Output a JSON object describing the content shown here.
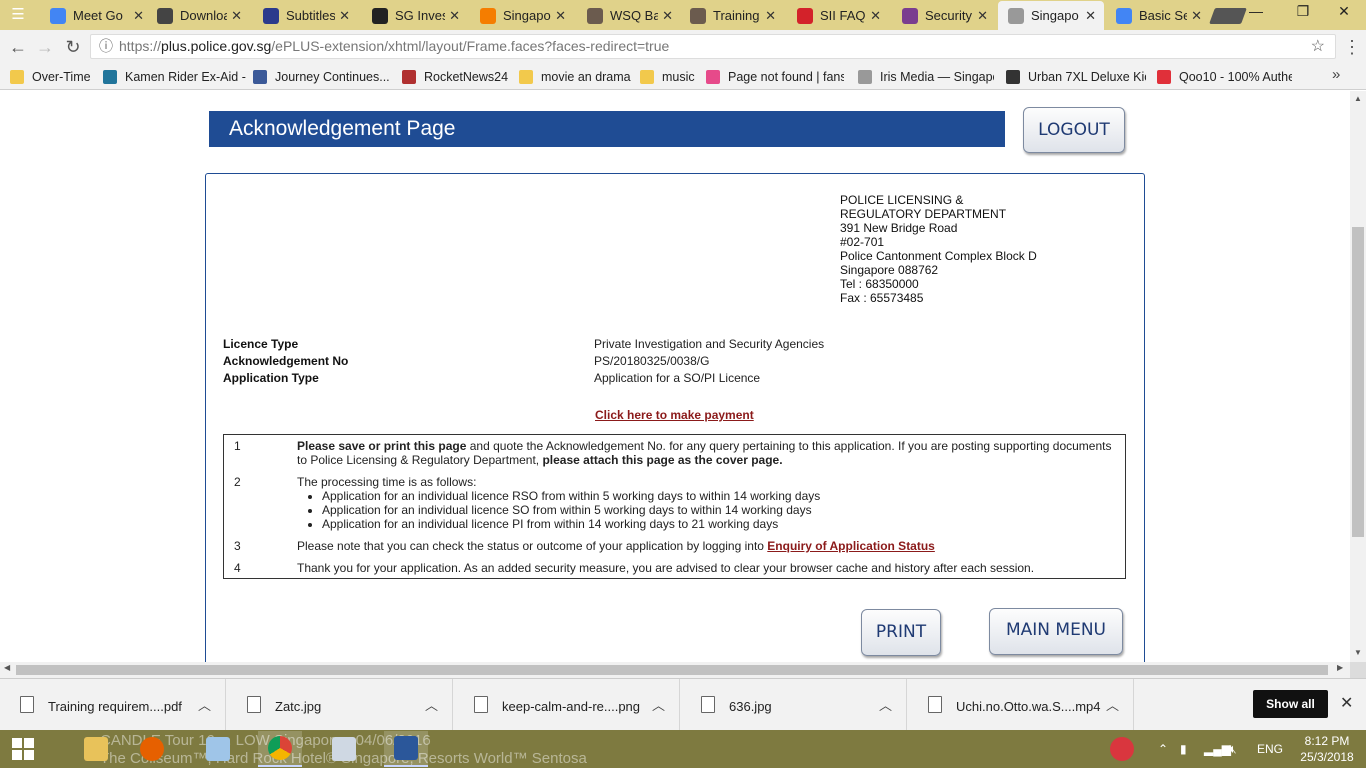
{
  "browser": {
    "tabs": [
      {
        "label": "Meet Go",
        "icon": "google-icon",
        "color": "#4285f4"
      },
      {
        "label": "Downloa",
        "icon": "user-silhouette-icon",
        "color": "#444444"
      },
      {
        "label": "Subtitles",
        "icon": "subtitles-icon",
        "color": "#2b3a8c"
      },
      {
        "label": "SG Inves",
        "icon": "sg-investigation-icon",
        "color": "#222222"
      },
      {
        "label": "Singapo",
        "icon": "blogger-icon",
        "color": "#f57d00"
      },
      {
        "label": "WSQ Ba",
        "icon": "wsq-icon",
        "color": "#6b5b4e"
      },
      {
        "label": "Training",
        "icon": "training-icon",
        "color": "#6b5b4e"
      },
      {
        "label": "SII FAQ |",
        "icon": "tp-icon",
        "color": "#d3222a"
      },
      {
        "label": "Security",
        "icon": "police-crest-icon",
        "color": "#7a3d8f"
      },
      {
        "label": "Singapo",
        "icon": "document-icon",
        "color": "#999999"
      },
      {
        "label": "Basic Se",
        "icon": "google-icon",
        "color": "#4285f4"
      }
    ],
    "url_prefix": "https://",
    "url_domain": "plus.police.gov.sg",
    "url_path": "/ePLUS-extension/xhtml/layout/Frame.faces?faces-redirect=true",
    "bookmarks": [
      {
        "label": "Over-Time",
        "icon": "folder-icon",
        "color": "#f2c94c"
      },
      {
        "label": "Kamen Rider Ex-Aid -",
        "icon": "wordpress-icon",
        "color": "#21759b"
      },
      {
        "label": "Journey Continues...",
        "icon": "facebook-icon",
        "color": "#3b5998"
      },
      {
        "label": "RocketNews24",
        "icon": "rocketnews-icon",
        "color": "#b03030"
      },
      {
        "label": "movie an drama",
        "icon": "folder-icon",
        "color": "#f2c94c"
      },
      {
        "label": "music",
        "icon": "folder-icon",
        "color": "#f2c94c"
      },
      {
        "label": "Page not found | fans",
        "icon": "fs-icon",
        "color": "#e64a8a"
      },
      {
        "label": "Iris Media — Singapo",
        "icon": "document-icon",
        "color": "#999999"
      },
      {
        "label": "Urban 7XL Deluxe Kic",
        "icon": "k-icon",
        "color": "#333333"
      },
      {
        "label": "Qoo10 - 100% Authe",
        "icon": "qoo10-icon",
        "color": "#e0303a"
      }
    ]
  },
  "page": {
    "title": "Acknowledgement Page",
    "logout_label": "LOGOUT",
    "address": [
      "POLICE LICENSING &",
      "REGULATORY DEPARTMENT",
      "391 New Bridge Road",
      "#02-701",
      "Police Cantonment Complex Block D",
      "Singapore 088762",
      "Tel : 68350000",
      "Fax : 65573485"
    ],
    "details": [
      {
        "label": "Licence Type",
        "value": "Private Investigation and Security Agencies"
      },
      {
        "label": "Acknowledgement No",
        "value": "PS/20180325/0038/G"
      },
      {
        "label": "Application Type",
        "value": "Application for a SO/PI Licence"
      }
    ],
    "payment_link": "Click here to make payment",
    "notes": {
      "n1": {
        "num": "1",
        "bold1": "Please save or print this page",
        "text1": " and quote the Acknowledgement No. for any query pertaining to this application. If you are posting supporting documents to Police Licensing & Regulatory Department, ",
        "bold2": "please attach this page as the cover page."
      },
      "n2": {
        "num": "2",
        "text": "The processing time is as follows:",
        "items": [
          "Application for an individual licence RSO from within 5 working days to within 14 working days",
          "Application for an individual licence SO from within 5 working days to within 14 working days",
          "Application for an individual licence PI from within 14 working days to 21 working days"
        ]
      },
      "n3": {
        "num": "3",
        "text": "Please note that you can check the status or outcome of your application by logging into ",
        "link": "Enquiry of Application Status"
      },
      "n4": {
        "num": "4",
        "text": "Thank you for your application. As an added security measure, you are advised to clear your browser cache and history after each session."
      }
    },
    "print_label": "PRINT",
    "main_menu_label": "MAIN MENU"
  },
  "downloads": {
    "items": [
      {
        "name": "Training requirem....pdf",
        "icon": "pdf-file-icon"
      },
      {
        "name": "Zatc.jpg",
        "icon": "image-file-icon"
      },
      {
        "name": "keep-calm-and-re....png",
        "icon": "image-file-icon"
      },
      {
        "name": "636.jpg",
        "icon": "image-file-icon"
      },
      {
        "name": "Uchi.no.Otto.wa.S....mp4",
        "icon": "video-file-icon"
      }
    ],
    "show_all": "Show all"
  },
  "taskbar": {
    "bg_text_line1": "CANDLE Tour 16 ... LOW Singapore - 04/06/2016",
    "bg_text_line2": "The Coliseum™, Hard Rock Hotel® Singapore, Resorts World™ Sentosa",
    "lang": "ENG",
    "time": "8:12 PM",
    "date": "25/3/2018",
    "colors": {
      "accent": "#1f4c94",
      "link": "#8b1a1a",
      "taskbar": "#7e7a40"
    }
  }
}
